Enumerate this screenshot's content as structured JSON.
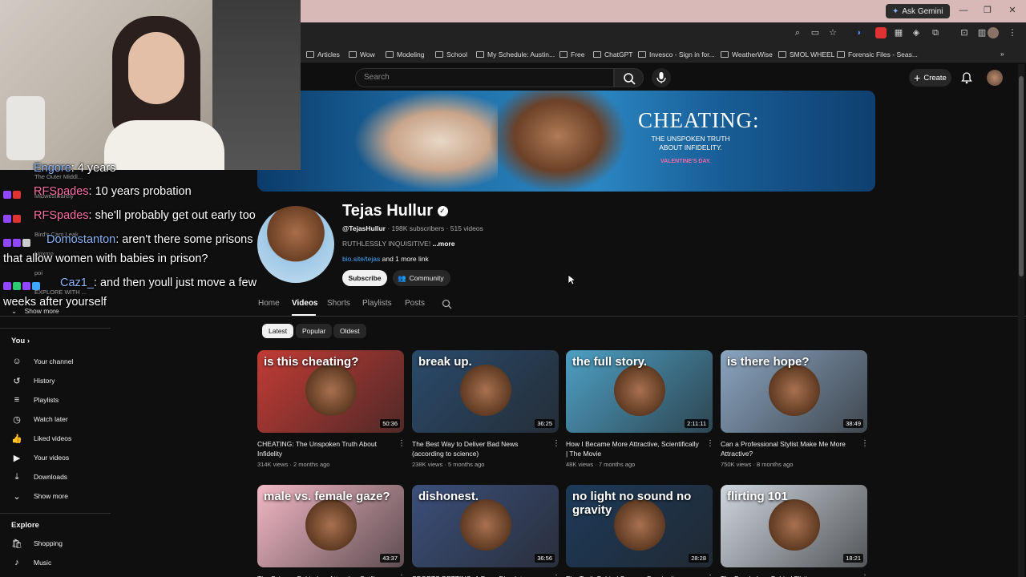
{
  "window": {
    "gemini_label": "Ask Gemini",
    "min": "—",
    "max": "❐",
    "close": "✕"
  },
  "bookmarks": [
    "Articles",
    "Wow",
    "Modeling",
    "School",
    "My Schedule: Austin...",
    "Free",
    "ChatGPT",
    "Invesco - Sign in for...",
    "WeatherWise",
    "SMOL WHEEL",
    "Forensic Files - Seas..."
  ],
  "header": {
    "search_placeholder": "Search",
    "create_label": "Create"
  },
  "banner": {
    "headline": "CHEATING:",
    "sub": "THE UNSPOKEN TRUTH\nABOUT INFIDELITY.",
    "tag": "VALENTINE'S DAY."
  },
  "channel": {
    "name": "Tejas Hullur",
    "handle": "@TejasHullur",
    "subscribers": "198K subscribers",
    "videos_count": "515 videos",
    "description": "RUTHLESSLY INQUISITIVE!",
    "more": "...more",
    "link": "bio.site/tejas",
    "more_links": "and 1 more link",
    "subscribe": "Subscribe",
    "community": "Community"
  },
  "tabs": [
    "Home",
    "Videos",
    "Shorts",
    "Playlists",
    "Posts"
  ],
  "chips": [
    "Latest",
    "Popular",
    "Oldest"
  ],
  "videos": [
    {
      "title": "CHEATING: The Unspoken Truth About Infidelity",
      "views": "314K views",
      "age": "2 months ago",
      "duration": "50:36",
      "overlay": "is this cheating?",
      "bg": "#c23b35"
    },
    {
      "title": "The Best Way to Deliver Bad News (according to science)",
      "views": "238K views",
      "age": "5 months ago",
      "duration": "36:25",
      "overlay": "break up.",
      "bg": "#2a4a6b"
    },
    {
      "title": "How I Became More Attractive, Scientifically | The Movie",
      "views": "48K views",
      "age": "7 months ago",
      "duration": "2:11:11",
      "overlay": "the full story.",
      "bg": "#4d9fc4"
    },
    {
      "title": "Can a Professional Stylist Make Me More Attractive?",
      "views": "750K views",
      "age": "8 months ago",
      "duration": "38:49",
      "overlay": "is there hope?",
      "bg": "#8aa4c0"
    },
    {
      "title": "The Science Behind an Attractive Outfit",
      "views": "",
      "age": "",
      "duration": "43:37",
      "overlay": "male vs. female gaze?",
      "bg": "#f2b8c6"
    },
    {
      "title": "SPORTS BETTING: A Deep Dive Into",
      "views": "",
      "age": "",
      "duration": "36:56",
      "overlay": "dishonest.",
      "bg": "#3b4f7a"
    },
    {
      "title": "The Truth Behind Sensory Deprivation",
      "views": "",
      "age": "",
      "duration": "28:28",
      "overlay": "no light no sound no gravity",
      "bg": "#1d3a5a"
    },
    {
      "title": "The Psychology Behind Flirting",
      "views": "",
      "age": "",
      "duration": "18:21",
      "overlay": "flirting 101",
      "bg": "#cfd6de"
    }
  ],
  "sidebar": {
    "you": "You",
    "items": [
      {
        "label": "Your channel",
        "icon": "person-icon"
      },
      {
        "label": "History",
        "icon": "history-icon"
      },
      {
        "label": "Playlists",
        "icon": "playlist-icon"
      },
      {
        "label": "Watch later",
        "icon": "clock-icon"
      },
      {
        "label": "Liked videos",
        "icon": "thumbs-up-icon"
      },
      {
        "label": "Your videos",
        "icon": "video-icon"
      },
      {
        "label": "Downloads",
        "icon": "download-icon"
      },
      {
        "label": "Show more",
        "icon": "chevron-down-icon"
      }
    ],
    "explore": "Explore",
    "explore_items": [
      {
        "label": "Shopping",
        "icon": "bag-icon"
      },
      {
        "label": "Music",
        "icon": "music-icon"
      }
    ],
    "show_more_top": "Show more"
  },
  "chat": [
    {
      "user": "Engore",
      "text": ": 4 years",
      "color": "#8ab4f8"
    },
    {
      "user": "RFSpades",
      "text": ": 10 years probation",
      "color": "#ff6fa6"
    },
    {
      "user": "RFSpades",
      "text": ": she'll probably get out early too",
      "color": "#ff6fa6"
    },
    {
      "user": "Domostanton",
      "text": ": aren't there some prisons",
      "cont": "that allow women with babies in prison?",
      "color": "#8ab4f8"
    },
    {
      "user": "Caz1_",
      "text": ": and then youll just move a few",
      "cont": "weeks after yourself",
      "color": "#8ab4f8"
    }
  ],
  "chat_bg_items": [
    "The Outer Middl...",
    "MidwestBarely",
    "Bird's Cam Leak",
    "Noxmo",
    "poi",
    "EXPLORE WITH ..."
  ]
}
